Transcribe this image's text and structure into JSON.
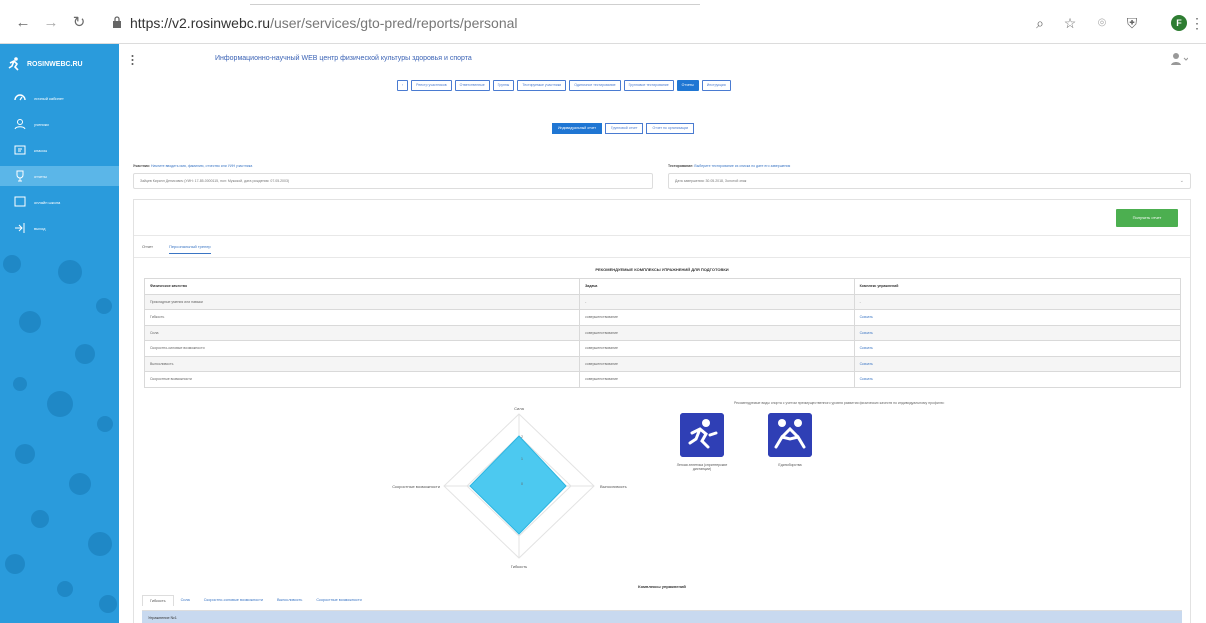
{
  "browser": {
    "url_host": "https://v2.rosinwebc.ru",
    "url_path": "/user/services/gto-pred/reports/personal",
    "profile_initial": "F"
  },
  "sidebar": {
    "logo": "ROSINWEBC.RU",
    "items": [
      {
        "label": "личный кабинет",
        "icon": "dashboard-icon"
      },
      {
        "label": "ученики",
        "icon": "user-icon"
      },
      {
        "label": "классы",
        "icon": "class-icon"
      },
      {
        "label": "отчеты",
        "icon": "trophy-icon",
        "active": true
      },
      {
        "label": "онлайн школа",
        "icon": "screen-icon"
      },
      {
        "label": "выход",
        "icon": "logout-icon"
      }
    ]
  },
  "header": {
    "site_title": "Информационно-научный WEB центр физической культуры здоровья и спорта"
  },
  "tabs": [
    {
      "label": "‹",
      "active": false
    },
    {
      "label": "Реестр участников",
      "active": false
    },
    {
      "label": "Ответственные",
      "active": false
    },
    {
      "label": "Группы",
      "active": false
    },
    {
      "label": "Тестируемые участники",
      "active": false
    },
    {
      "label": "Одиночное тестирование",
      "active": false
    },
    {
      "label": "Групповое тестирование",
      "active": false
    },
    {
      "label": "Отчеты",
      "active": true
    },
    {
      "label": "Инструкция",
      "active": false
    }
  ],
  "report_tabs": [
    {
      "label": "Индивидуальный отчет",
      "active": true
    },
    {
      "label": "Групповой отчет",
      "active": false
    },
    {
      "label": "Отчет по организации",
      "active": false
    }
  ],
  "participant": {
    "label": "Участник:",
    "hint": "Начните вводить имя, фамилию, отчество или УИН участника",
    "value": "Зайцев Кирилл Денисович (УИН: 17-85-0000115, пол: Мужской, дата рождения: 07.05.2003)"
  },
  "testing": {
    "label": "Тестирование:",
    "hint": "Выберите тестирование из списка по дате его завершения",
    "value": "Дата завершения: 30.05.2018, Золотой знак"
  },
  "panel": {
    "get_report_label": "Получить отчет",
    "inner_tabs": [
      {
        "label": "Отчет",
        "active": false
      },
      {
        "label": "Персональный тренер",
        "active": true
      }
    ],
    "rec_title": "РЕКОМЕНДУЕМЫЕ КОМПЛЕКСЫ УПРАЖНЕНИЙ ДЛЯ ПОДГОТОВКИ",
    "table_headers": [
      "Физическое качество",
      "Задача",
      "Комплекс упражнений"
    ],
    "table_rows": [
      [
        "Прикладные умения или навыки",
        "-",
        "-"
      ],
      [
        "Гибкость",
        "совершенствование",
        "Скачать"
      ],
      [
        "Сила",
        "совершенствование",
        "Скачать"
      ],
      [
        "Скоростно-силовые возможности",
        "совершенствование",
        "Скачать"
      ],
      [
        "Выносливость",
        "совершенствование",
        "Скачать"
      ],
      [
        "Скоростные возможности",
        "совершенствование",
        "Скачать"
      ]
    ],
    "radar_labels": {
      "top": "Сила",
      "right": "Выносливость",
      "bottom": "Гибкость",
      "left": "Скоростные возможности"
    },
    "radar_ticks": [
      "2",
      "1",
      "0"
    ],
    "sport_note": "Рекомендуемые виды спорта с учетом преимущественного уровня развития физических качеств по индивидуальному профилю:",
    "sports": [
      {
        "label": "Легкая атлетика (спринтерские дистанции)",
        "icon": "sprint-icon"
      },
      {
        "label": "Единоборства",
        "icon": "wrestling-icon"
      }
    ],
    "ex_title": "Комплексы упражнений",
    "ex_tabs": [
      {
        "label": "Гибкость",
        "active": true
      },
      {
        "label": "Сила",
        "active": false
      },
      {
        "label": "Скоростно-силовые возможности",
        "active": false
      },
      {
        "label": "Выносливость",
        "active": false
      },
      {
        "label": "Скоростные возможности",
        "active": false
      }
    ],
    "ex_row": "Упражнение №1"
  },
  "colors": {
    "sidebar": "#2a9bdc",
    "accent": "#1f76d3",
    "success": "#4caf50",
    "radar_fill": "#4cc9f0"
  }
}
